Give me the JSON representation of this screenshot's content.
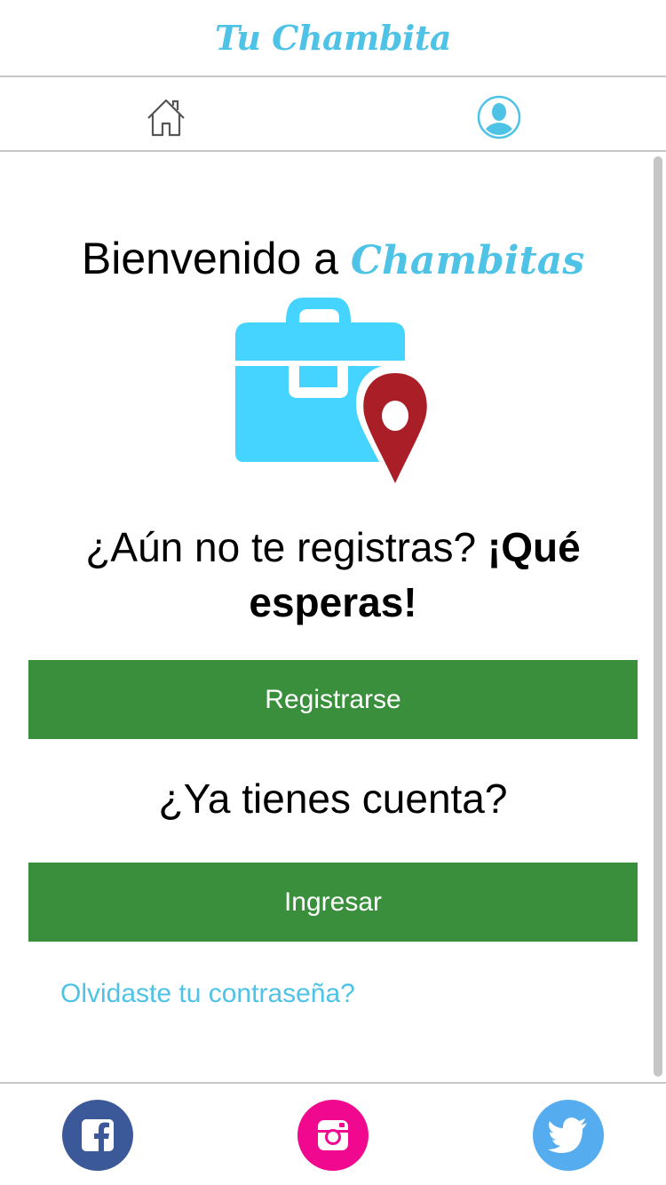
{
  "header": {
    "title": "Tu Chambita"
  },
  "nav": {
    "home_icon": "home-icon",
    "profile_icon": "user-icon"
  },
  "welcome": {
    "prefix": "Bienvenido a ",
    "brand": "Chambitas"
  },
  "hero": {
    "icon": "briefcase-location-icon"
  },
  "register_prompt": {
    "text": "¿Aún no te registras? ",
    "emphasis": "¡Qué esperas!"
  },
  "buttons": {
    "register": "Registrarse",
    "login": "Ingresar"
  },
  "login_prompt": "¿Ya tienes cuenta?",
  "forgot_link": "Olvidaste tu contraseña?",
  "footer": {
    "social": [
      {
        "name": "facebook",
        "icon": "facebook-icon"
      },
      {
        "name": "instagram",
        "icon": "instagram-icon"
      },
      {
        "name": "twitter",
        "icon": "twitter-icon"
      }
    ]
  },
  "colors": {
    "accent": "#4fc3e6",
    "button": "#3a8f3d",
    "briefcase": "#45d4ff",
    "pin": "#aa1e27",
    "facebook": "#3b5998",
    "instagram": "#f0098f",
    "twitter": "#55acee"
  }
}
